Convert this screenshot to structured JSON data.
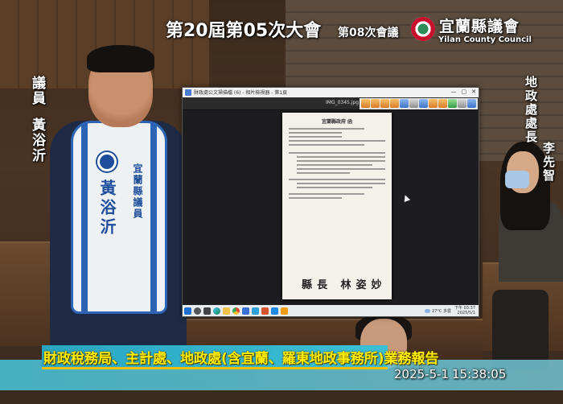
{
  "broadcast": {
    "session_title": "第20屆第05次大會",
    "meeting_number": "第08次會議",
    "council_name": "宜蘭縣議會",
    "council_name_en": "Yilan County Council",
    "report_title": "財政稅務局、主計處、地政處(含宜蘭、羅東地政事務所)業務報告",
    "date": "2025-5-1",
    "time": "15:38:05"
  },
  "speaker": {
    "role": "議員",
    "name": "黃浴沂",
    "vest_name": "黃浴沂",
    "vest_org": "宜蘭縣議員"
  },
  "official": {
    "role": "地政處處長",
    "name": "李先智"
  },
  "viewer": {
    "window_title": "財政處公文掃描檔 (6) - 相片檢視器 - 第1頁",
    "window_controls": [
      "—",
      "▢",
      "✕"
    ],
    "filename": "IMG_0345.jpg",
    "document_header": "宜蘭縣政府 函",
    "signature": "縣長 林姿妙"
  },
  "taskbar": {
    "weather": "27°C 多雲",
    "clock_time": "下午 03:37",
    "clock_date": "2025/5/1"
  },
  "colors": {
    "report_title_text": "#ffee00",
    "ticker_bar": "#46bed2",
    "vest_blue": "#2c63b5"
  }
}
